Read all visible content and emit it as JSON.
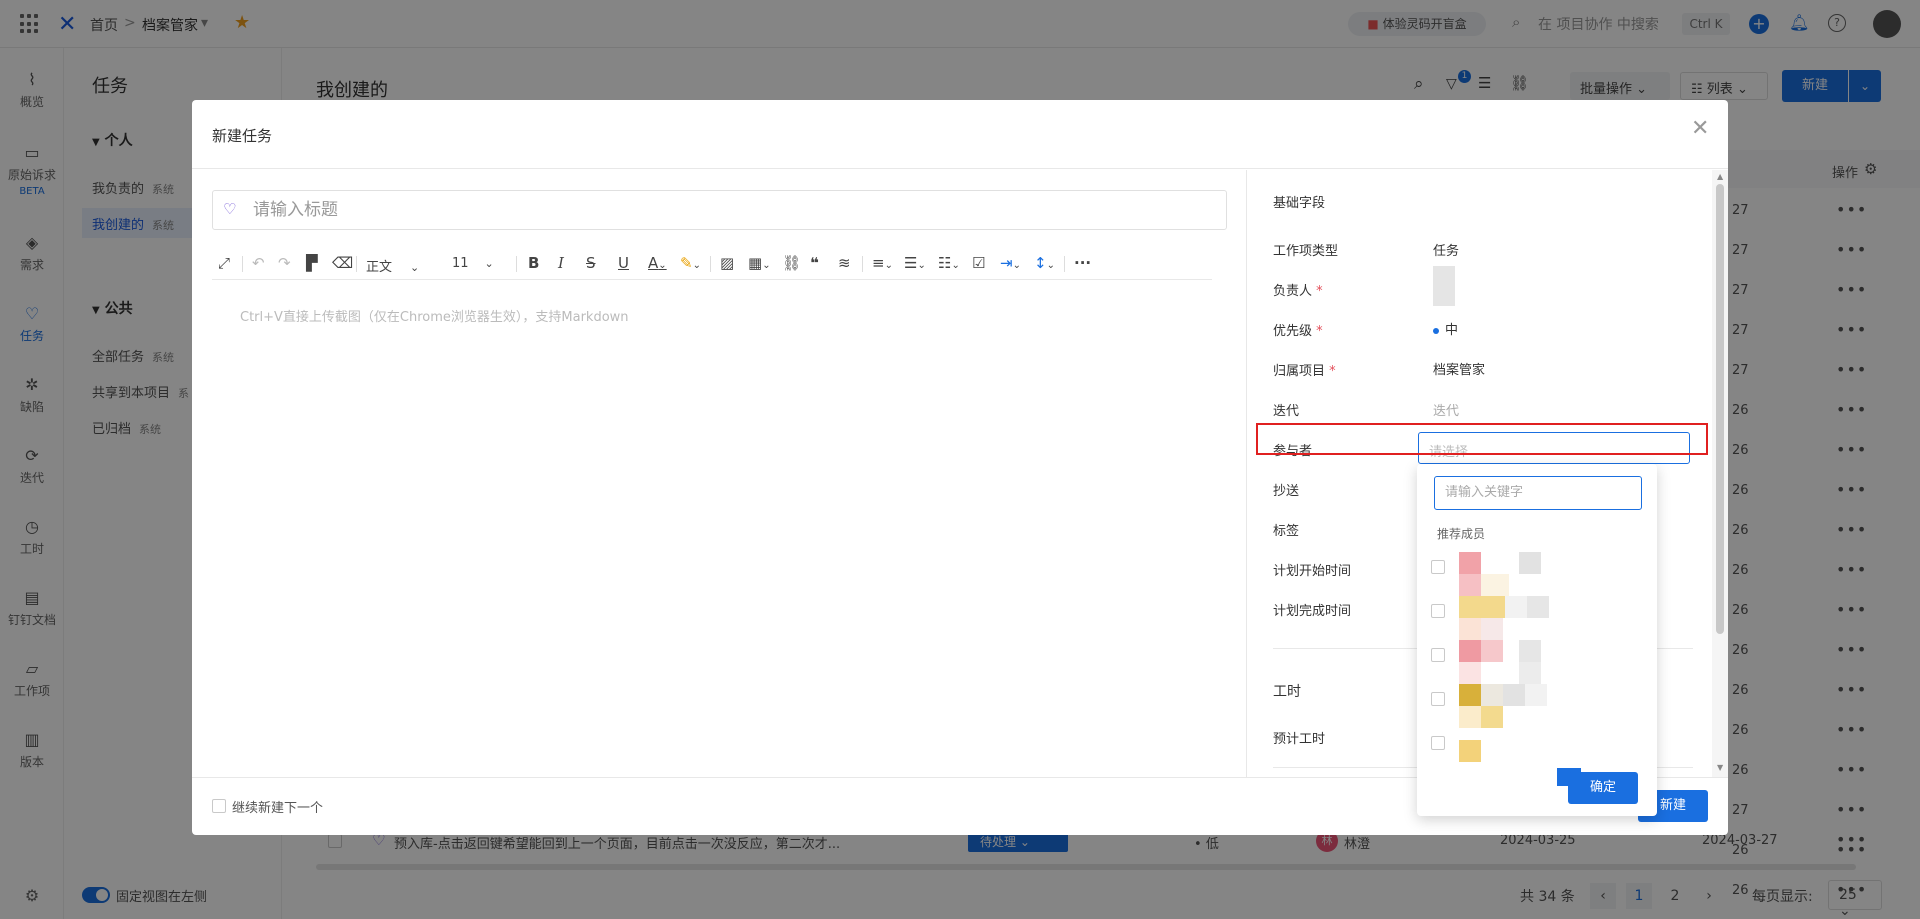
{
  "topbar": {
    "home": "首页",
    "sep": ">",
    "project": "档案管家",
    "project_caret": "▾",
    "promo": "体验灵码开盲盒",
    "search_placeholder": "在 项目协作 中搜索",
    "shortcut": "Ctrl K"
  },
  "leftnav": {
    "items": [
      {
        "label": "概览",
        "icon": "chart-icon"
      },
      {
        "label": "原始诉求",
        "icon": "inbox-icon",
        "badge": "BETA"
      },
      {
        "label": "需求",
        "icon": "layers-icon"
      },
      {
        "label": "任务",
        "icon": "bulb-icon"
      },
      {
        "label": "缺陷",
        "icon": "bug-icon"
      },
      {
        "label": "迭代",
        "icon": "iteration-icon"
      },
      {
        "label": "工时",
        "icon": "timer-icon"
      },
      {
        "label": "钉钉文档",
        "icon": "doc-icon"
      },
      {
        "label": "工作项",
        "icon": "folder-icon"
      },
      {
        "label": "版本",
        "icon": "book-icon"
      }
    ]
  },
  "sidepanel": {
    "title": "任务",
    "personal": "个人",
    "public": "公共",
    "personal_items": [
      {
        "label": "我负责的",
        "tag": "系统"
      },
      {
        "label": "我创建的",
        "tag": "系统"
      }
    ],
    "public_items": [
      {
        "label": "全部任务",
        "tag": "系统"
      },
      {
        "label": "共享到本项目",
        "tag": "系"
      },
      {
        "label": "已归档",
        "tag": "系统"
      }
    ],
    "pin_label": "固定视图在左侧"
  },
  "main": {
    "title": "我创建的",
    "filter_count": "1",
    "batch": "批量操作",
    "view": "列表",
    "new": "新建",
    "col_ops": "操作",
    "dates": [
      "27",
      "27",
      "27",
      "27",
      "27",
      "26",
      "26",
      "26",
      "26",
      "26",
      "26",
      "26",
      "26",
      "26",
      "26",
      "27",
      "26",
      "26"
    ],
    "bottom_row": {
      "title": "预入库-点击返回键希望能回到上一个页面，目前点击一次没反应，第二次才...",
      "status": "待处理",
      "priority": "低",
      "assignee": "林澄",
      "avatar_initial": "林",
      "start": "2024-03-25",
      "end": "2024-03-27"
    },
    "pager": {
      "total": "共 34 条",
      "page1": "1",
      "page2": "2",
      "per_page_label": "每页显示:",
      "per_page": "25"
    }
  },
  "modal": {
    "title": "新建任务",
    "title_placeholder": "请输入标题",
    "editor_placeholder": "Ctrl+V直接上传截图（仅在Chrome浏览器生效），支持Markdown",
    "toolbar": {
      "paragraph": "正文",
      "font_size": "11"
    },
    "right": {
      "section": "基础字段",
      "fields": {
        "type_label": "工作项类型",
        "type_value": "任务",
        "assignee_label": "负责人",
        "priority_label": "优先级",
        "priority_value": "中",
        "project_label": "归属项目",
        "project_value": "档案管家",
        "iteration_label": "迭代",
        "iteration_value": "迭代",
        "participants_label": "参与者",
        "participants_placeholder": "请选择",
        "cc_label": "抄送",
        "tags_label": "标签",
        "start_label": "计划开始时间",
        "end_label": "计划完成时间"
      },
      "worktime_section": "工时",
      "estimate_label": "预计工时"
    },
    "footer": {
      "continue_label": "继续新建下一个",
      "submit": "新建"
    },
    "required_mark": "*"
  },
  "dropdown": {
    "search_placeholder": "请输入关键字",
    "section": "推荐成员",
    "confirm": "确定"
  },
  "colors": {
    "accent": "#1a6fe0",
    "highlight_border": "#e02020",
    "required": "#e34d59"
  }
}
